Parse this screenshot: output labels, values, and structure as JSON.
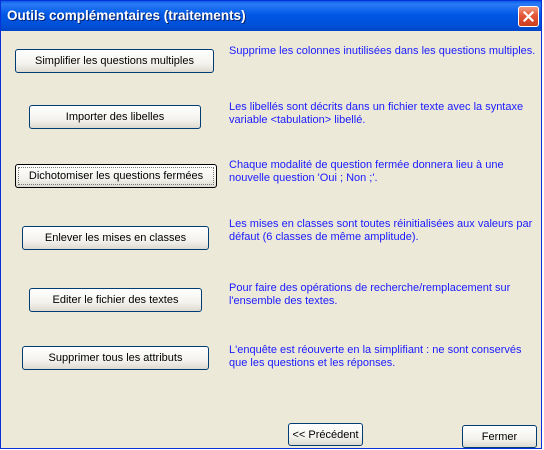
{
  "window": {
    "title": "Outils complémentaires (traitements)"
  },
  "tools": [
    {
      "button_label": "Simplifier les questions multiples",
      "description": "Supprime les colonnes inutilisées dans les questions multiples."
    },
    {
      "button_label": "Importer des libelles",
      "description": "Les libellés sont décrits dans un fichier texte avec la syntaxe variable <tabulation> libellé."
    },
    {
      "button_label": "Dichotomiser les questions fermées",
      "description": "Chaque modalité de question fermée donnera lieu à une nouvelle question 'Oui ; Non ;'."
    },
    {
      "button_label": "Enlever les mises en classes",
      "description": "Les mises en classes sont toutes réinitialisées aux valeurs par défaut (6 classes de même amplitude)."
    },
    {
      "button_label": "Editer le fichier des textes",
      "description": "Pour faire des opérations de recherche/remplacement sur l'ensemble des textes."
    },
    {
      "button_label": "Supprimer tous les attributs",
      "description": "L'enquête est réouverte en la simplifiant : ne sont conservés que les questions et les réponses."
    }
  ],
  "footer": {
    "previous_label": "<< Précédent",
    "close_label": "Fermer"
  }
}
